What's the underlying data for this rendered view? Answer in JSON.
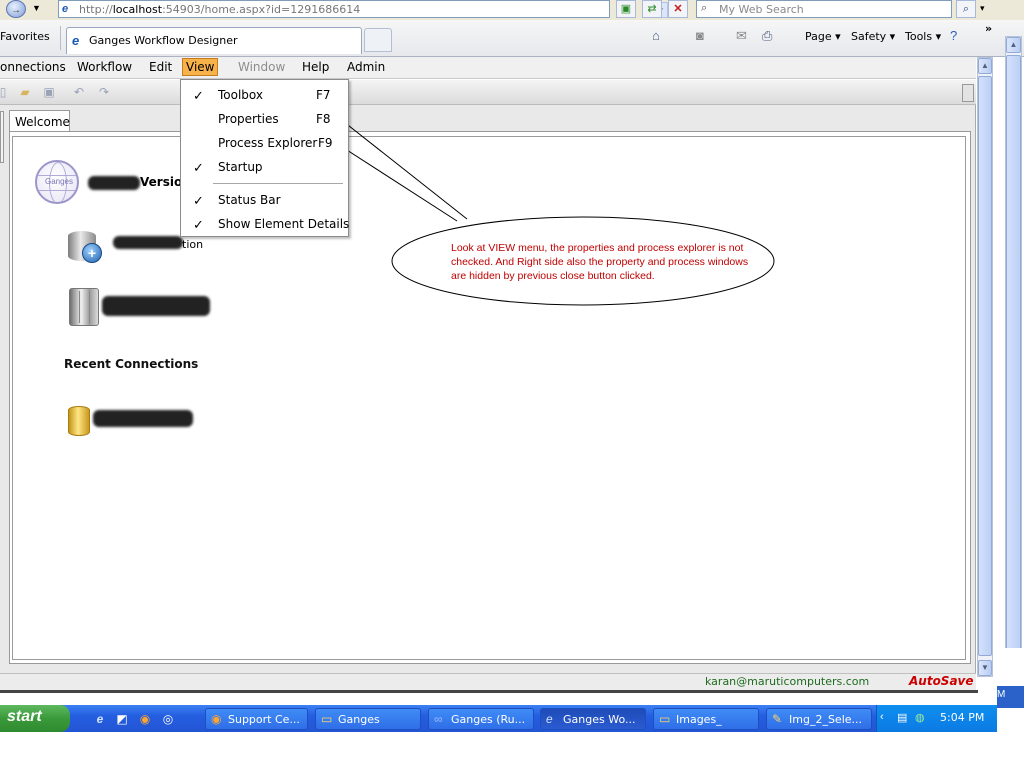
{
  "browser": {
    "url_host_prefix": "http://",
    "url_host": "localhost",
    "url_rest": ":54903/home.aspx?id=1291686614",
    "search_placeholder": "My Web Search",
    "favorites_label": "Favorites",
    "tab_title": "Ganges Workflow Designer",
    "commands": {
      "page": "Page ▾",
      "safety": "Safety ▾",
      "tools": "Tools ▾"
    },
    "more_chevron": "»"
  },
  "app_menu": {
    "items": [
      "onnections",
      "Workflow",
      "Edit",
      "View",
      "Window",
      "Help",
      "Admin"
    ]
  },
  "doc_tab_label": "Welcome",
  "view_menu": {
    "items": [
      {
        "label": "Toolbox",
        "shortcut": "F7",
        "checked": "✓"
      },
      {
        "label": "Properties",
        "shortcut": "F8",
        "checked": ""
      },
      {
        "label": "Process Explorer",
        "shortcut": "F9",
        "checked": ""
      },
      {
        "label": "Startup",
        "shortcut": "",
        "checked": "✓"
      },
      {
        "label": "Status Bar",
        "shortcut": "",
        "checked": "✓"
      },
      {
        "label": "Show Element Details",
        "shortcut": "",
        "checked": "✓"
      }
    ]
  },
  "welcome": {
    "globe_label": "Ganges",
    "version_text": "Version",
    "connection_fragment": "tion",
    "recent_title": "Recent Connections"
  },
  "callout": {
    "text": "Look at VIEW menu, the properties and process explorer is not checked. And Right side also the property and process windows are hidden by previous close button clicked."
  },
  "status": {
    "email": "karan@maruticomputers.com",
    "autosave": "AutoSave"
  },
  "taskbar": {
    "start_label": "start",
    "tasks": [
      "Support Ce...",
      "Ganges",
      "Ganges (Ru...",
      "Ganges Wo...",
      "Images_",
      "Img_2_Sele..."
    ],
    "active_task_index": 3,
    "clock": "5:04 PM",
    "desktop_fragment": "M"
  },
  "colors": {
    "menu_highlight": "#f8b24a",
    "callout_text": "#c00000",
    "status_email": "#1d6b1d",
    "autosave": "#cc0000",
    "taskbar": "#245ee0",
    "start_button": "#3a9a3a"
  }
}
